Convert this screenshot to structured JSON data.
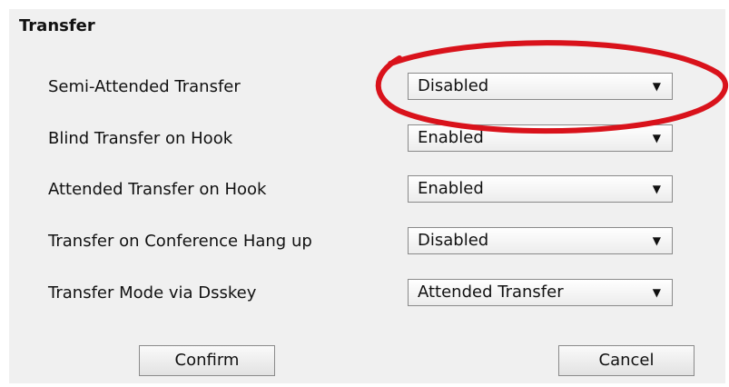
{
  "section": {
    "title": "Transfer"
  },
  "rows": [
    {
      "label": "Semi-Attended Transfer",
      "value": "Disabled"
    },
    {
      "label": "Blind Transfer on Hook",
      "value": "Enabled"
    },
    {
      "label": "Attended Transfer on Hook",
      "value": "Enabled"
    },
    {
      "label": "Transfer on Conference Hang up",
      "value": "Disabled"
    },
    {
      "label": "Transfer Mode via Dsskey",
      "value": "Attended Transfer"
    }
  ],
  "buttons": {
    "confirm": "Confirm",
    "cancel": "Cancel"
  },
  "icons": {
    "dropdown": "dropdown-arrow-icon"
  },
  "colors": {
    "highlight": "#d9121b"
  }
}
